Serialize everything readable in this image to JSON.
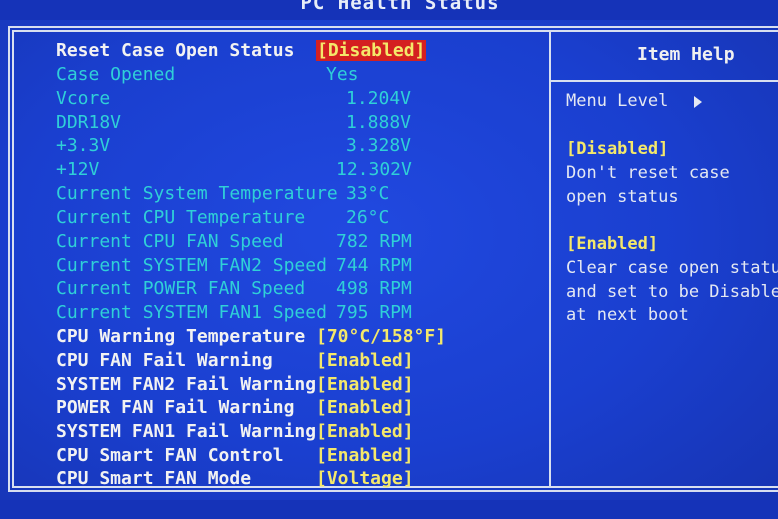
{
  "header": {
    "title": "PC Health Status"
  },
  "settings": [
    {
      "label": "Reset Case Open Status",
      "value": "[Disabled]"
    },
    {
      "label": "Case Opened",
      "value": "Yes"
    },
    {
      "label": "Vcore",
      "value": "1.204V"
    },
    {
      "label": "DDR18V",
      "value": "1.888V"
    },
    {
      "label": "+3.3V",
      "value": "3.328V"
    },
    {
      "label": "+12V",
      "value": "12.302V"
    },
    {
      "label": "Current System Temperature",
      "value": "33°C"
    },
    {
      "label": "Current CPU Temperature",
      "value": "26°C"
    },
    {
      "label": "Current CPU FAN Speed",
      "value": "782 RPM"
    },
    {
      "label": "Current SYSTEM FAN2 Speed",
      "value": "744 RPM"
    },
    {
      "label": "Current POWER FAN Speed",
      "value": "498 RPM"
    },
    {
      "label": "Current SYSTEM FAN1 Speed",
      "value": "795 RPM"
    },
    {
      "label": "CPU Warning Temperature",
      "value": "[70°C/158°F]"
    },
    {
      "label": "CPU FAN Fail Warning",
      "value": "[Enabled]"
    },
    {
      "label": "SYSTEM FAN2 Fail Warning",
      "value": "[Enabled]"
    },
    {
      "label": "POWER FAN Fail Warning",
      "value": "[Enabled]"
    },
    {
      "label": "SYSTEM FAN1 Fail Warning",
      "value": "[Enabled]"
    },
    {
      "label": "CPU Smart FAN Control",
      "value": "[Enabled]"
    },
    {
      "label": "CPU Smart FAN Mode",
      "value": "[Voltage]"
    }
  ],
  "help": {
    "title": "Item Help",
    "menu_level": "Menu Level",
    "option1_name": "[Disabled]",
    "option1_desc1": "Don't reset case",
    "option1_desc2": "open status",
    "option2_name": "[Enabled]",
    "option2_desc1": "Clear case open status",
    "option2_desc2": "and set to be Disabled",
    "option2_desc3": "at next boot"
  },
  "colors": {
    "background": "#1a3fcf",
    "info_text": "#2fd0d8",
    "setting_text": "#f2f2f2",
    "value_text": "#f4e86a",
    "selection": "#d42020"
  }
}
